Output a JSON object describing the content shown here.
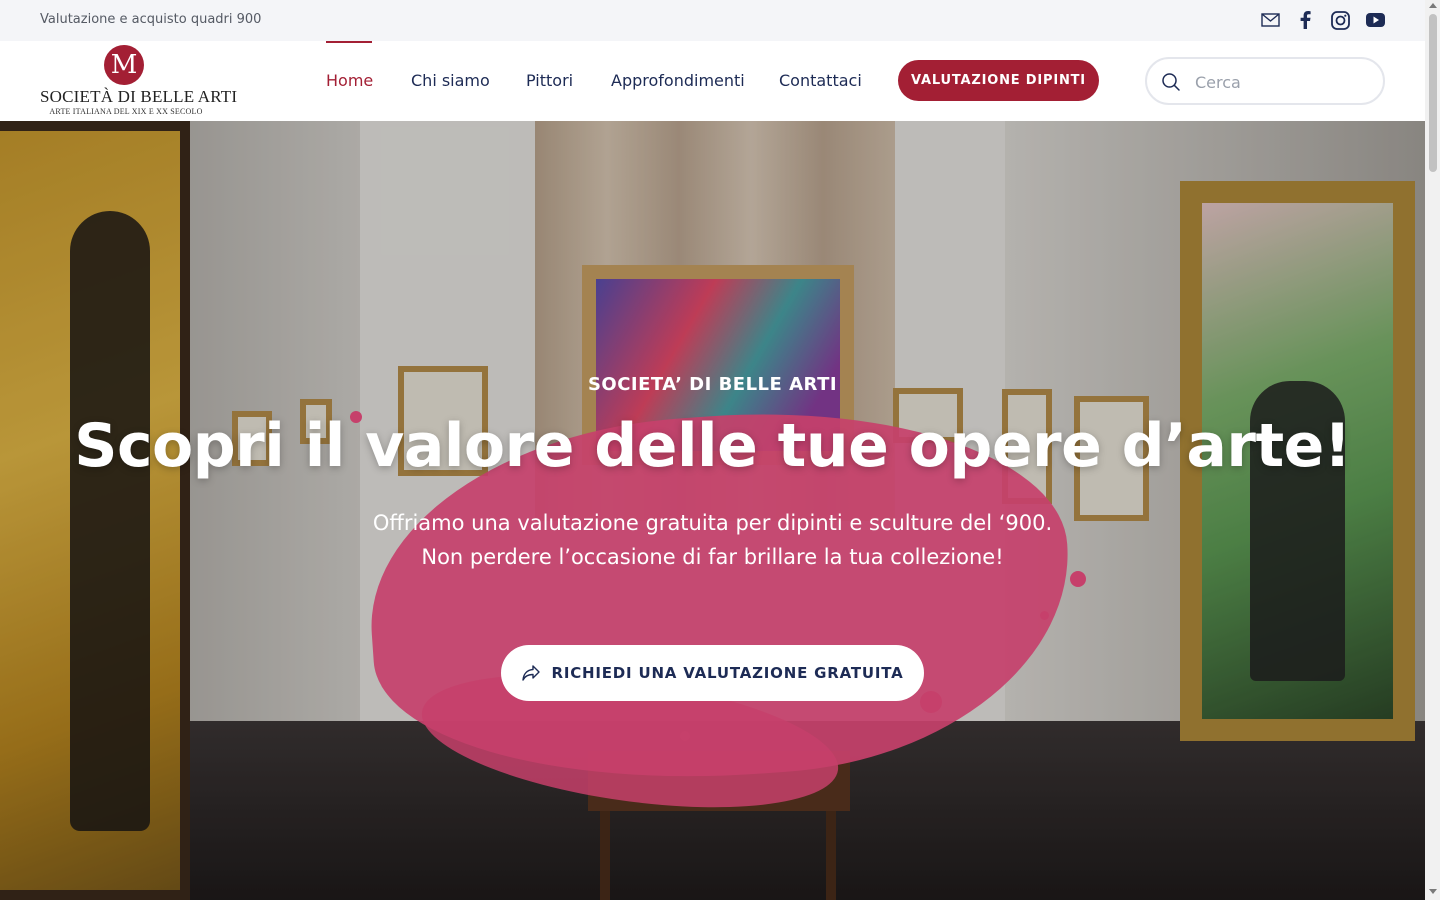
{
  "topbar": {
    "tagline": "Valutazione e acquisto quadri 900",
    "social": [
      "mail-icon",
      "facebook-icon",
      "instagram-icon",
      "youtube-icon"
    ]
  },
  "logo": {
    "mark": "M",
    "name": "SOCIETÀ DI BELLE ARTI",
    "subtitle": "ARTE ITALIANA DEL XIX E XX SECOLO"
  },
  "nav": {
    "items": [
      {
        "label": "Home",
        "active": true
      },
      {
        "label": "Chi siamo",
        "active": false
      },
      {
        "label": "Pittori",
        "active": false
      },
      {
        "label": "Approfondimenti",
        "active": false
      },
      {
        "label": "Contattaci",
        "active": false
      }
    ],
    "cta_label": "VALUTAZIONE DIPINTI"
  },
  "search": {
    "placeholder": "Cerca",
    "value": ""
  },
  "hero": {
    "kicker": "SOCIETA’ DI BELLE ARTI",
    "title": "Scopri il valore delle tue opere d’arte!",
    "subtitle_line1": "Offriamo una valutazione gratuita per dipinti e sculture del ‘900.",
    "subtitle_line2": "Non perdere l’occasione di far brillare la tua collezione!",
    "cta_label": "RICHIEDI UNA VALUTAZIONE GRATUITA",
    "cta_icon": "share-arrow-icon"
  },
  "colors": {
    "brand": "#a31f34",
    "navy": "#1d2b55",
    "accent_pink": "#f24f83",
    "topbar_bg": "#f4f5f8"
  }
}
